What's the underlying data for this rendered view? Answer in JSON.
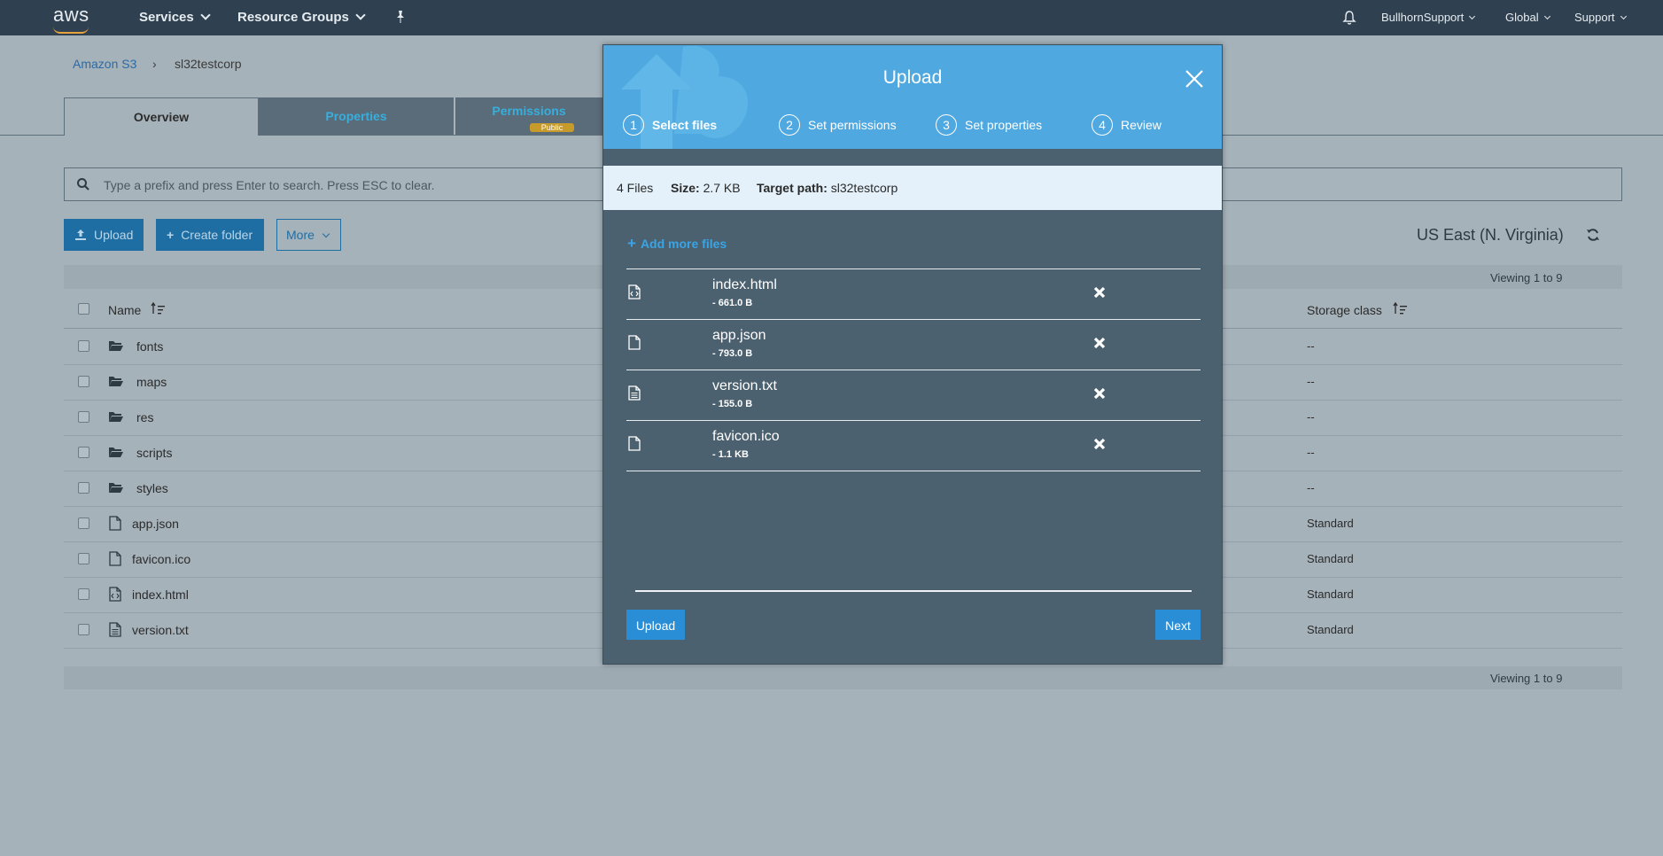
{
  "topbar": {
    "logo_text": "aws",
    "services_label": "Services",
    "resource_groups_label": "Resource Groups",
    "pin_icon": "pin-icon",
    "bell_icon": "bell-icon",
    "account_label": "BullhornSupport",
    "region_label": "Global",
    "support_label": "Support"
  },
  "breadcrumb": {
    "root": "Amazon S3",
    "separator": "›",
    "bucket": "sl32testcorp"
  },
  "tabs": [
    {
      "label": "Overview"
    },
    {
      "label": "Properties"
    },
    {
      "label": "Permissions",
      "badge": "Public"
    }
  ],
  "search": {
    "placeholder": "Type a prefix and press Enter to search. Press ESC to clear."
  },
  "toolbar": {
    "upload_label": "Upload",
    "create_folder_label": "Create folder",
    "more_label": "More",
    "region": "US East (N. Virginia)"
  },
  "table": {
    "viewing_top": "Viewing 1 to 9",
    "viewing_bottom": "Viewing 1 to 9",
    "col_name": "Name",
    "col_storage": "Storage class",
    "rows": [
      {
        "name": "fonts",
        "type": "folder",
        "storage": "--"
      },
      {
        "name": "maps",
        "type": "folder",
        "storage": "--"
      },
      {
        "name": "res",
        "type": "folder",
        "storage": "--"
      },
      {
        "name": "scripts",
        "type": "folder",
        "storage": "--"
      },
      {
        "name": "styles",
        "type": "folder",
        "storage": "--"
      },
      {
        "name": "app.json",
        "type": "file",
        "storage": "Standard"
      },
      {
        "name": "favicon.ico",
        "type": "file",
        "storage": "Standard"
      },
      {
        "name": "index.html",
        "type": "code-file",
        "storage": "Standard"
      },
      {
        "name": "version.txt",
        "type": "text-file",
        "storage": "Standard"
      }
    ]
  },
  "modal": {
    "title": "Upload",
    "steps": [
      {
        "num": "1",
        "label": "Select files"
      },
      {
        "num": "2",
        "label": "Set permissions"
      },
      {
        "num": "3",
        "label": "Set properties"
      },
      {
        "num": "4",
        "label": "Review"
      }
    ],
    "info": {
      "files": "4 Files",
      "size_label": "Size:",
      "size_value": "2.7 KB",
      "target_label": "Target path:",
      "target_value": "sl32testcorp"
    },
    "add_more_label": "Add more files",
    "files": [
      {
        "name": "index.html",
        "size": "- 661.0 B",
        "icon": "code-file-icon"
      },
      {
        "name": "app.json",
        "size": "- 793.0 B",
        "icon": "file-icon"
      },
      {
        "name": "version.txt",
        "size": "- 155.0 B",
        "icon": "text-file-icon"
      },
      {
        "name": "favicon.ico",
        "size": "- 1.1 KB",
        "icon": "file-icon"
      }
    ],
    "upload_button": "Upload",
    "next_button": "Next"
  },
  "colors": {
    "topbar": "#2f4050",
    "modal_header": "#4fa8df",
    "modal_body": "#4c6170",
    "button_blue": "#2a8ed6",
    "overlay_bg": "#a6b2ba"
  }
}
